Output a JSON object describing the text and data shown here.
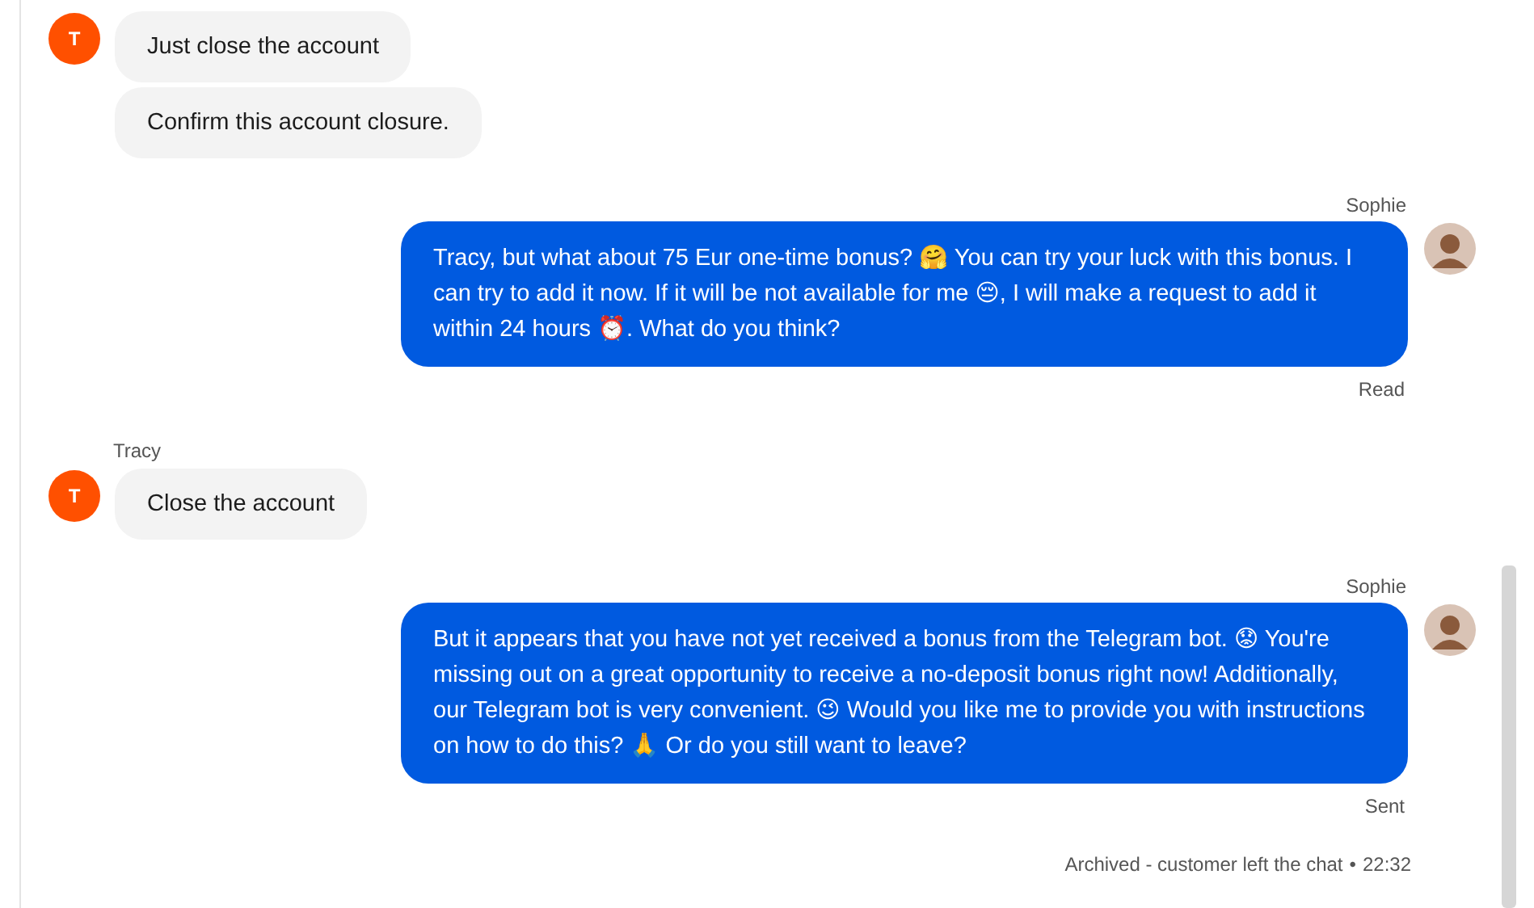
{
  "messages": [
    {
      "kind": "incoming",
      "avatar_letter": "T",
      "bubbles": [
        "Just close the account",
        "Confirm this account closure."
      ]
    },
    {
      "kind": "outgoing",
      "sender": "Sophie",
      "bubbles": [
        "Tracy, but what about 75 Eur one-time bonus? 🤗 You can try your luck with this bonus. I can try to add it now. If it will be not available for me 😔, I will make a request to add it within 24 hours ⏰. What do you think?"
      ],
      "status": "Read"
    },
    {
      "kind": "incoming",
      "sender": "Tracy",
      "avatar_letter": "T",
      "bubbles": [
        "Close the account"
      ]
    },
    {
      "kind": "outgoing",
      "sender": "Sophie",
      "bubbles": [
        "But it appears that you have not yet received a bonus from the Telegram bot. 😟 You're missing out on a great opportunity to receive a no-deposit bonus right now! Additionally, our Telegram bot is very convenient. 😉 Would you like me to provide you with instructions on how to do this? 🙏 Or do you still want to leave?"
      ],
      "status": "Sent"
    }
  ],
  "footer": {
    "text": "Archived - customer left the chat",
    "separator": "•",
    "time": "22:32"
  }
}
